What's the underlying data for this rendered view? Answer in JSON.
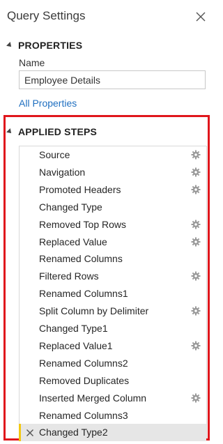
{
  "panel": {
    "title": "Query Settings"
  },
  "properties": {
    "heading": "PROPERTIES",
    "name_label": "Name",
    "name_value": "Employee Details",
    "all_properties_link": "All Properties"
  },
  "applied_steps": {
    "heading": "APPLIED STEPS",
    "steps": [
      {
        "label": "Source",
        "has_gear": true
      },
      {
        "label": "Navigation",
        "has_gear": true
      },
      {
        "label": "Promoted Headers",
        "has_gear": true
      },
      {
        "label": "Changed Type",
        "has_gear": false
      },
      {
        "label": "Removed Top Rows",
        "has_gear": true
      },
      {
        "label": "Replaced Value",
        "has_gear": true
      },
      {
        "label": "Renamed Columns",
        "has_gear": false
      },
      {
        "label": "Filtered Rows",
        "has_gear": true
      },
      {
        "label": "Renamed Columns1",
        "has_gear": false
      },
      {
        "label": "Split Column by Delimiter",
        "has_gear": true
      },
      {
        "label": "Changed Type1",
        "has_gear": false
      },
      {
        "label": "Replaced Value1",
        "has_gear": true
      },
      {
        "label": "Renamed Columns2",
        "has_gear": false
      },
      {
        "label": "Removed Duplicates",
        "has_gear": false
      },
      {
        "label": "Inserted Merged Column",
        "has_gear": true
      },
      {
        "label": "Renamed Columns3",
        "has_gear": false
      },
      {
        "label": "Changed Type2",
        "has_gear": false,
        "selected": true
      }
    ]
  },
  "colors": {
    "highlight_border": "#e0161c",
    "link": "#1f6fc0",
    "selected_marker": "#f2c811",
    "selected_background": "#e6e6e6"
  }
}
